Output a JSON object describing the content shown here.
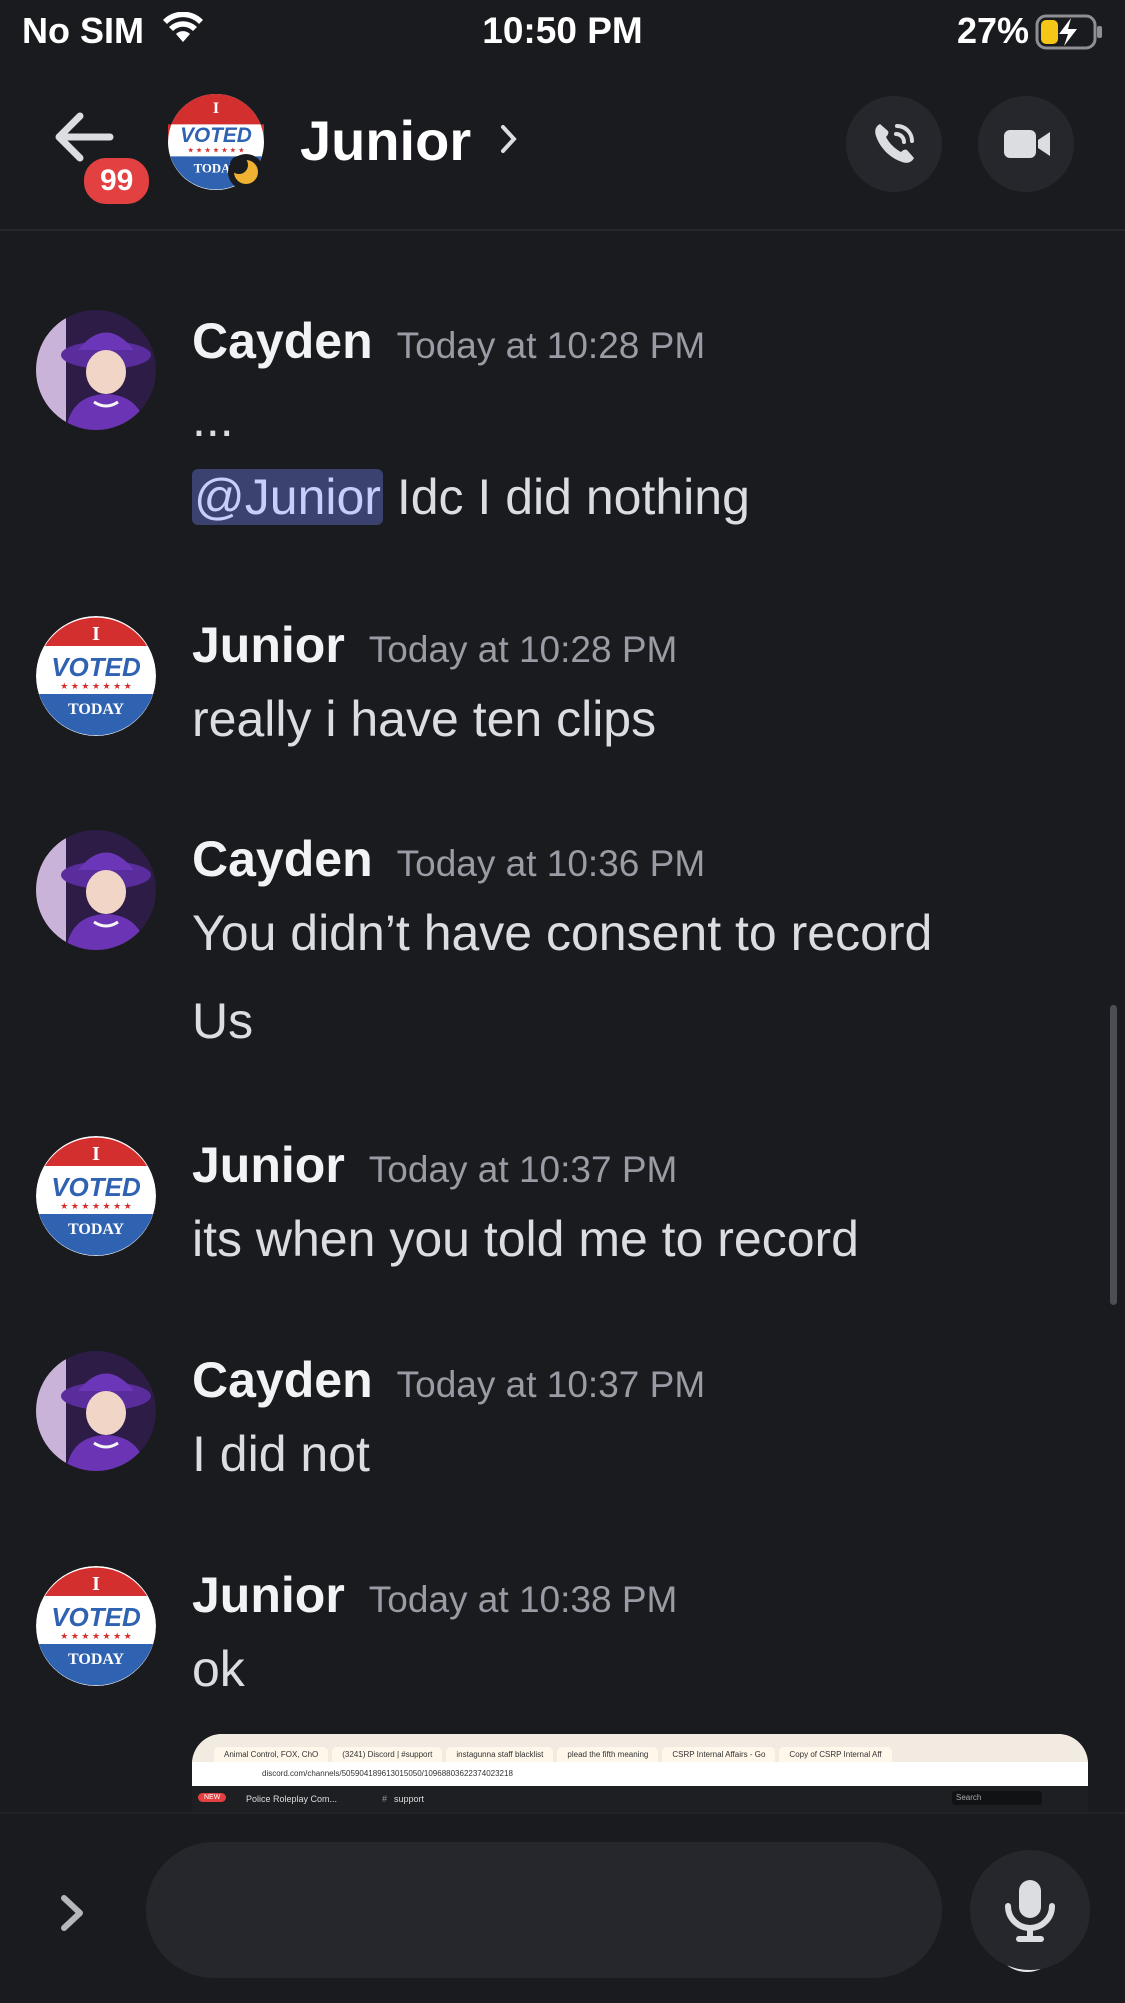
{
  "status_bar": {
    "carrier": "No SIM",
    "time": "10:50 PM",
    "battery_percent": "27%"
  },
  "header": {
    "unread_badge": "99",
    "channel_name": "Junior",
    "icons": [
      "back-arrow-icon",
      "chevron-right-icon",
      "phone-call-icon",
      "video-camera-icon"
    ],
    "avatar_status": "idle"
  },
  "messages": [
    {
      "author": "Cayden",
      "timestamp": "Today at 10:28 PM",
      "line1": "...",
      "mention": "@Junior",
      "line2_text": " Idc I did nothing"
    },
    {
      "author": "Junior",
      "timestamp": "Today at 10:28 PM",
      "line1": "really i have ten clips"
    },
    {
      "author": "Cayden",
      "timestamp": "Today at 10:36 PM",
      "line1": "You didn’t have consent to record",
      "line2": "Us"
    },
    {
      "author": "Junior",
      "timestamp": "Today at 10:37 PM",
      "line1": "its when you told me to record"
    },
    {
      "author": "Cayden",
      "timestamp": "Today at 10:37 PM",
      "line1": "I did not"
    },
    {
      "author": "Junior",
      "timestamp": "Today at 10:38 PM",
      "line1": "ok"
    }
  ],
  "attachment": {
    "tabs": [
      "Animal Control, FOX, ChO",
      "(3241) Discord | #support",
      "instagunna staff blacklist",
      "plead the fifth meaning",
      "CSRP Internal Affairs - Go",
      "Copy of CSRP Internal Aff"
    ],
    "url": "discord.com/channels/505904189613015050/1096880362237402321​8",
    "server_name": "Police Roleplay Com...",
    "channel": "support",
    "new_label": "NEW",
    "search_placeholder": "Search"
  },
  "colors": {
    "background": "#1a1b1e",
    "mention_bg": "#3c4270",
    "badge": "#e34141",
    "timestamp": "#9a9ca5"
  }
}
